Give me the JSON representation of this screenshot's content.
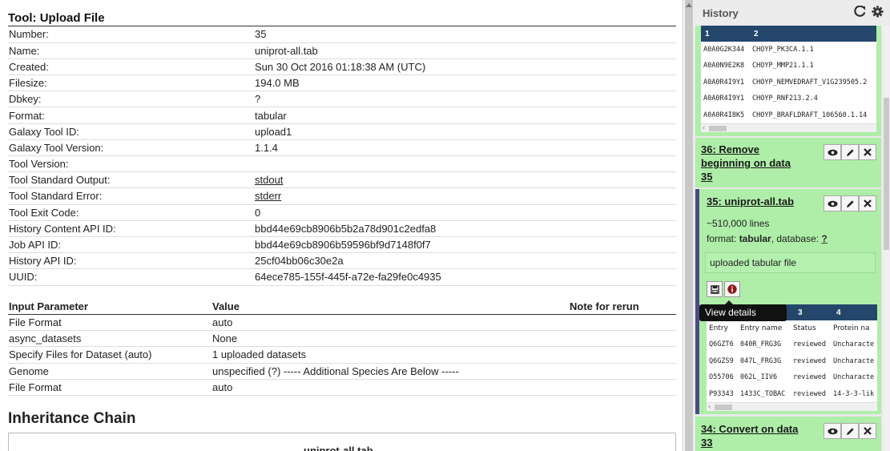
{
  "tool": {
    "title": "Tool: Upload File",
    "info": [
      {
        "key": "Number:",
        "value": "35"
      },
      {
        "key": "Name:",
        "value": "uniprot-all.tab"
      },
      {
        "key": "Created:",
        "value": "Sun 30 Oct 2016 01:18:38 AM (UTC)"
      },
      {
        "key": "Filesize:",
        "value": "194.0 MB"
      },
      {
        "key": "Dbkey:",
        "value": "?"
      },
      {
        "key": "Format:",
        "value": "tabular"
      },
      {
        "key": "Galaxy Tool ID:",
        "value": "upload1"
      },
      {
        "key": "Galaxy Tool Version:",
        "value": "1.1.4"
      },
      {
        "key": "Tool Version:",
        "value": ""
      },
      {
        "key": "Tool Standard Output:",
        "value": "stdout"
      },
      {
        "key": "Tool Standard Error:",
        "value": "stderr"
      },
      {
        "key": "Tool Exit Code:",
        "value": "0"
      },
      {
        "key": "History Content API ID:",
        "value": "bbd44e69cb8906b5b2a78d901c2edfa8"
      },
      {
        "key": "Job API ID:",
        "value": "bbd44e69cb8906b59596bf9d7148f0f7"
      },
      {
        "key": "History API ID:",
        "value": "25cf04bb06c30e2a"
      },
      {
        "key": "UUID:",
        "value": "64ece785-155f-445f-a72e-fa29fe0c4935"
      }
    ],
    "params_headers": {
      "param": "Input Parameter",
      "value": "Value",
      "note": "Note for rerun"
    },
    "params": [
      {
        "param": "File Format",
        "value": "auto"
      },
      {
        "param": "async_datasets",
        "value": "None"
      },
      {
        "param": "Specify Files for Dataset (auto)",
        "value": "1 uploaded datasets"
      },
      {
        "param": "Genome",
        "value": "unspecified (?) ----- Additional Species Are Below -----"
      },
      {
        "param": "File Format",
        "value": "auto"
      }
    ],
    "inheritance_title": "Inheritance Chain",
    "chain_item": "uniprot-all.tab"
  },
  "history": {
    "title": "History",
    "refresh_icon": "refresh-icon",
    "options_icon": "gear-icon",
    "top_peek": {
      "headers": [
        "1",
        "2"
      ],
      "rows": [
        [
          "A0A0G2K344",
          "CHOYP_PK3CA.1.1"
        ],
        [
          "A0A0N9E2K8",
          "CHOYP_MMP21.1.1"
        ],
        [
          "A0A0R4I9Y1",
          "CHOYP_NEMVEDRAFT_V1G239505.2"
        ],
        [
          "A0A0R4I9Y1",
          "CHOYP_RNF213.2.4"
        ],
        [
          "A0A0R4I8K5",
          "CHOYP_BRAFLDRAFT_106560.1.14"
        ]
      ]
    },
    "item36": {
      "name_line1": "36: Remove",
      "name_line2": "beginning on data",
      "name_line3": "35"
    },
    "item35": {
      "name": "35: uniprot-all.tab",
      "lines": "~510,000 lines",
      "format_label": "format: ",
      "format": "tabular",
      "db_label": ", database: ",
      "db": "?",
      "info": "uploaded tabular file",
      "tooltip": "View details",
      "peek_headers": [
        "3",
        "4"
      ],
      "peek_col_labels": [
        "Entry",
        "Entry name",
        "Status",
        "Protein na"
      ],
      "peek_rows": [
        [
          "Q6GZT6",
          "040R_FRG3G",
          "reviewed",
          "Uncharacte"
        ],
        [
          "Q6GZS9",
          "047L_FRG3G",
          "reviewed",
          "Uncharacte"
        ],
        [
          "O55706",
          "062L_IIV6",
          "reviewed",
          "Uncharacte"
        ],
        [
          "P93343",
          "1433C_TOBAC",
          "reviewed",
          "14-3-3-lik"
        ]
      ]
    },
    "item34": {
      "name_line1": "34: Convert on data",
      "name_line2": "33"
    }
  }
}
